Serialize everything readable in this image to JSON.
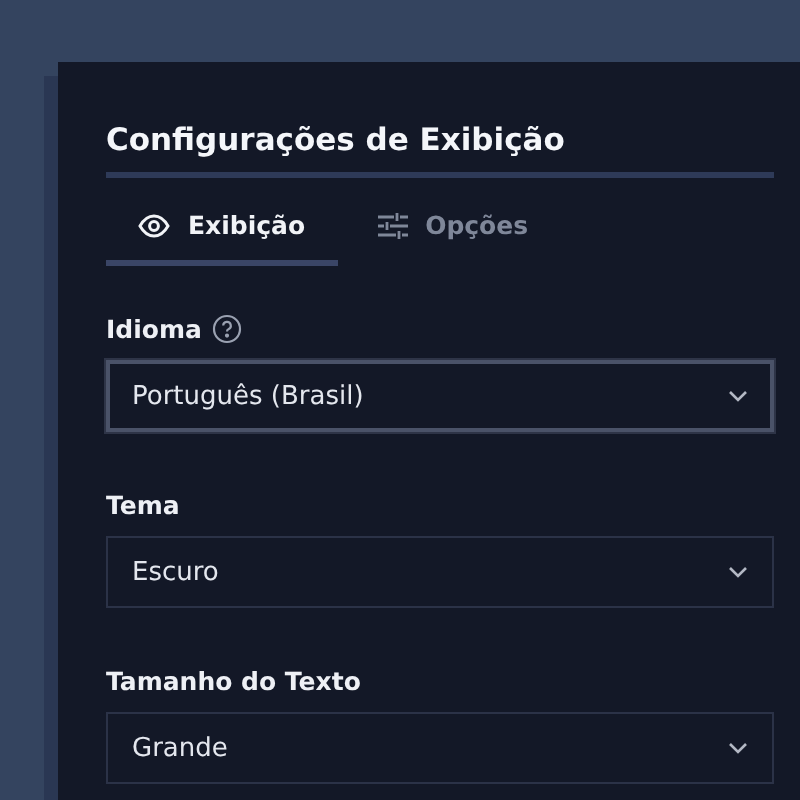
{
  "panel": {
    "title": "Configurações de Exibição"
  },
  "tabs": [
    {
      "label": "Exibição",
      "kind": "eye",
      "selected": true
    },
    {
      "label": "Opções",
      "kind": "sliders",
      "selected": false
    }
  ],
  "fields": [
    {
      "label": "Idioma",
      "help": true,
      "value": "Português (Brasil)",
      "focused": true
    },
    {
      "label": "Tema",
      "help": false,
      "value": "Escuro",
      "focused": false
    },
    {
      "label": "Tamanho do Texto",
      "help": false,
      "value": "Grande",
      "focused": false
    }
  ]
}
